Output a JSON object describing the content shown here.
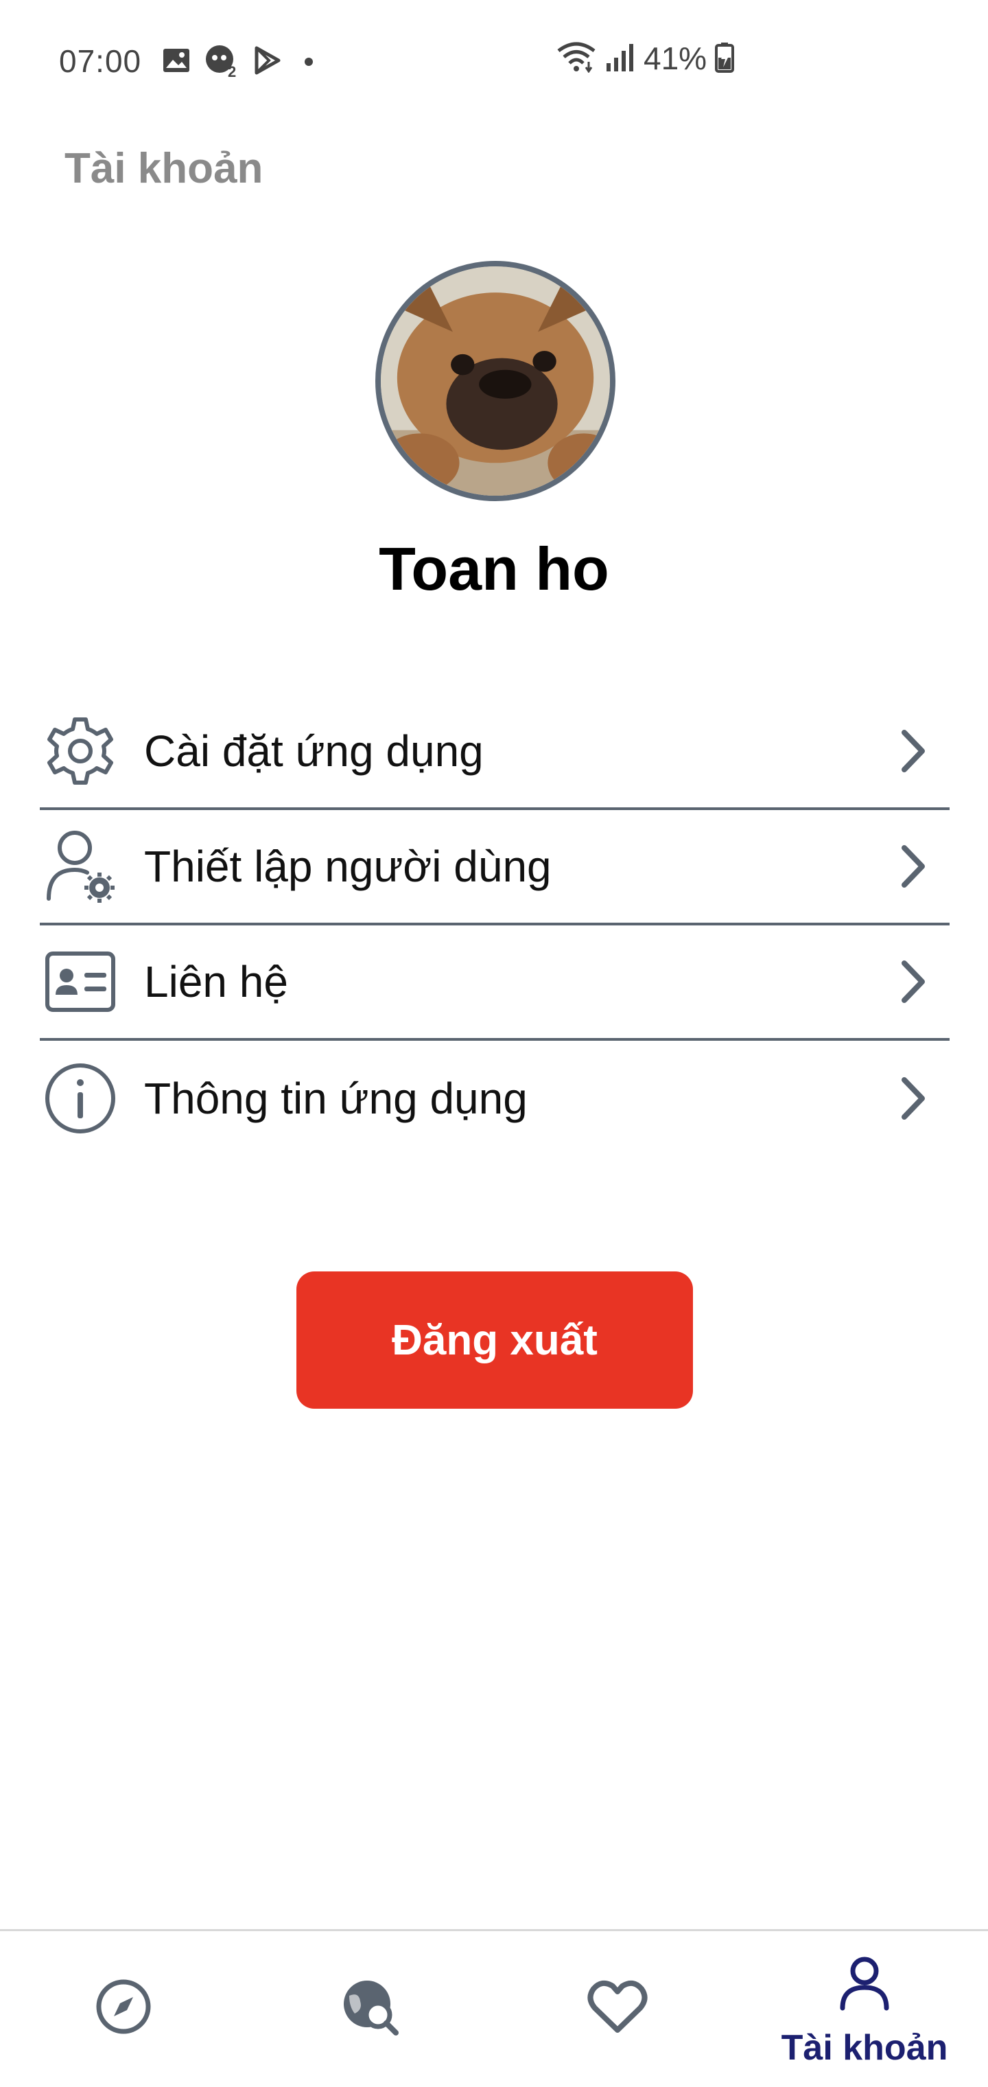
{
  "status_bar": {
    "time": "07:00",
    "battery": "41%",
    "icons": [
      "image-icon",
      "game-app-icon",
      "play-store-icon",
      "dot-icon",
      "wifi-icon",
      "signal-icon",
      "battery-charging-icon"
    ]
  },
  "header": {
    "title": "Tài khoản"
  },
  "profile": {
    "name": "Toan ho",
    "avatar": "dog-avatar"
  },
  "menu": {
    "items": [
      {
        "label": "Cài đặt ứng dụng",
        "icon": "gear-icon"
      },
      {
        "label": "Thiết lập người dùng",
        "icon": "user-settings-icon"
      },
      {
        "label": "Liên hệ",
        "icon": "contact-card-icon"
      },
      {
        "label": "Thông tin ứng dụng",
        "icon": "info-icon"
      }
    ]
  },
  "logout": {
    "label": "Đăng xuất"
  },
  "bottom_nav": {
    "items": [
      {
        "icon": "compass-icon",
        "label": ""
      },
      {
        "icon": "globe-search-icon",
        "label": ""
      },
      {
        "icon": "heart-icon",
        "label": ""
      },
      {
        "icon": "account-icon",
        "label": "Tài khoản",
        "active": true
      }
    ],
    "active_color": "#1c2070",
    "inactive_color": "#5a6470"
  },
  "colors": {
    "accent_red": "#e83424",
    "divider": "#5a6470",
    "title_gray": "#8a8a8a"
  }
}
